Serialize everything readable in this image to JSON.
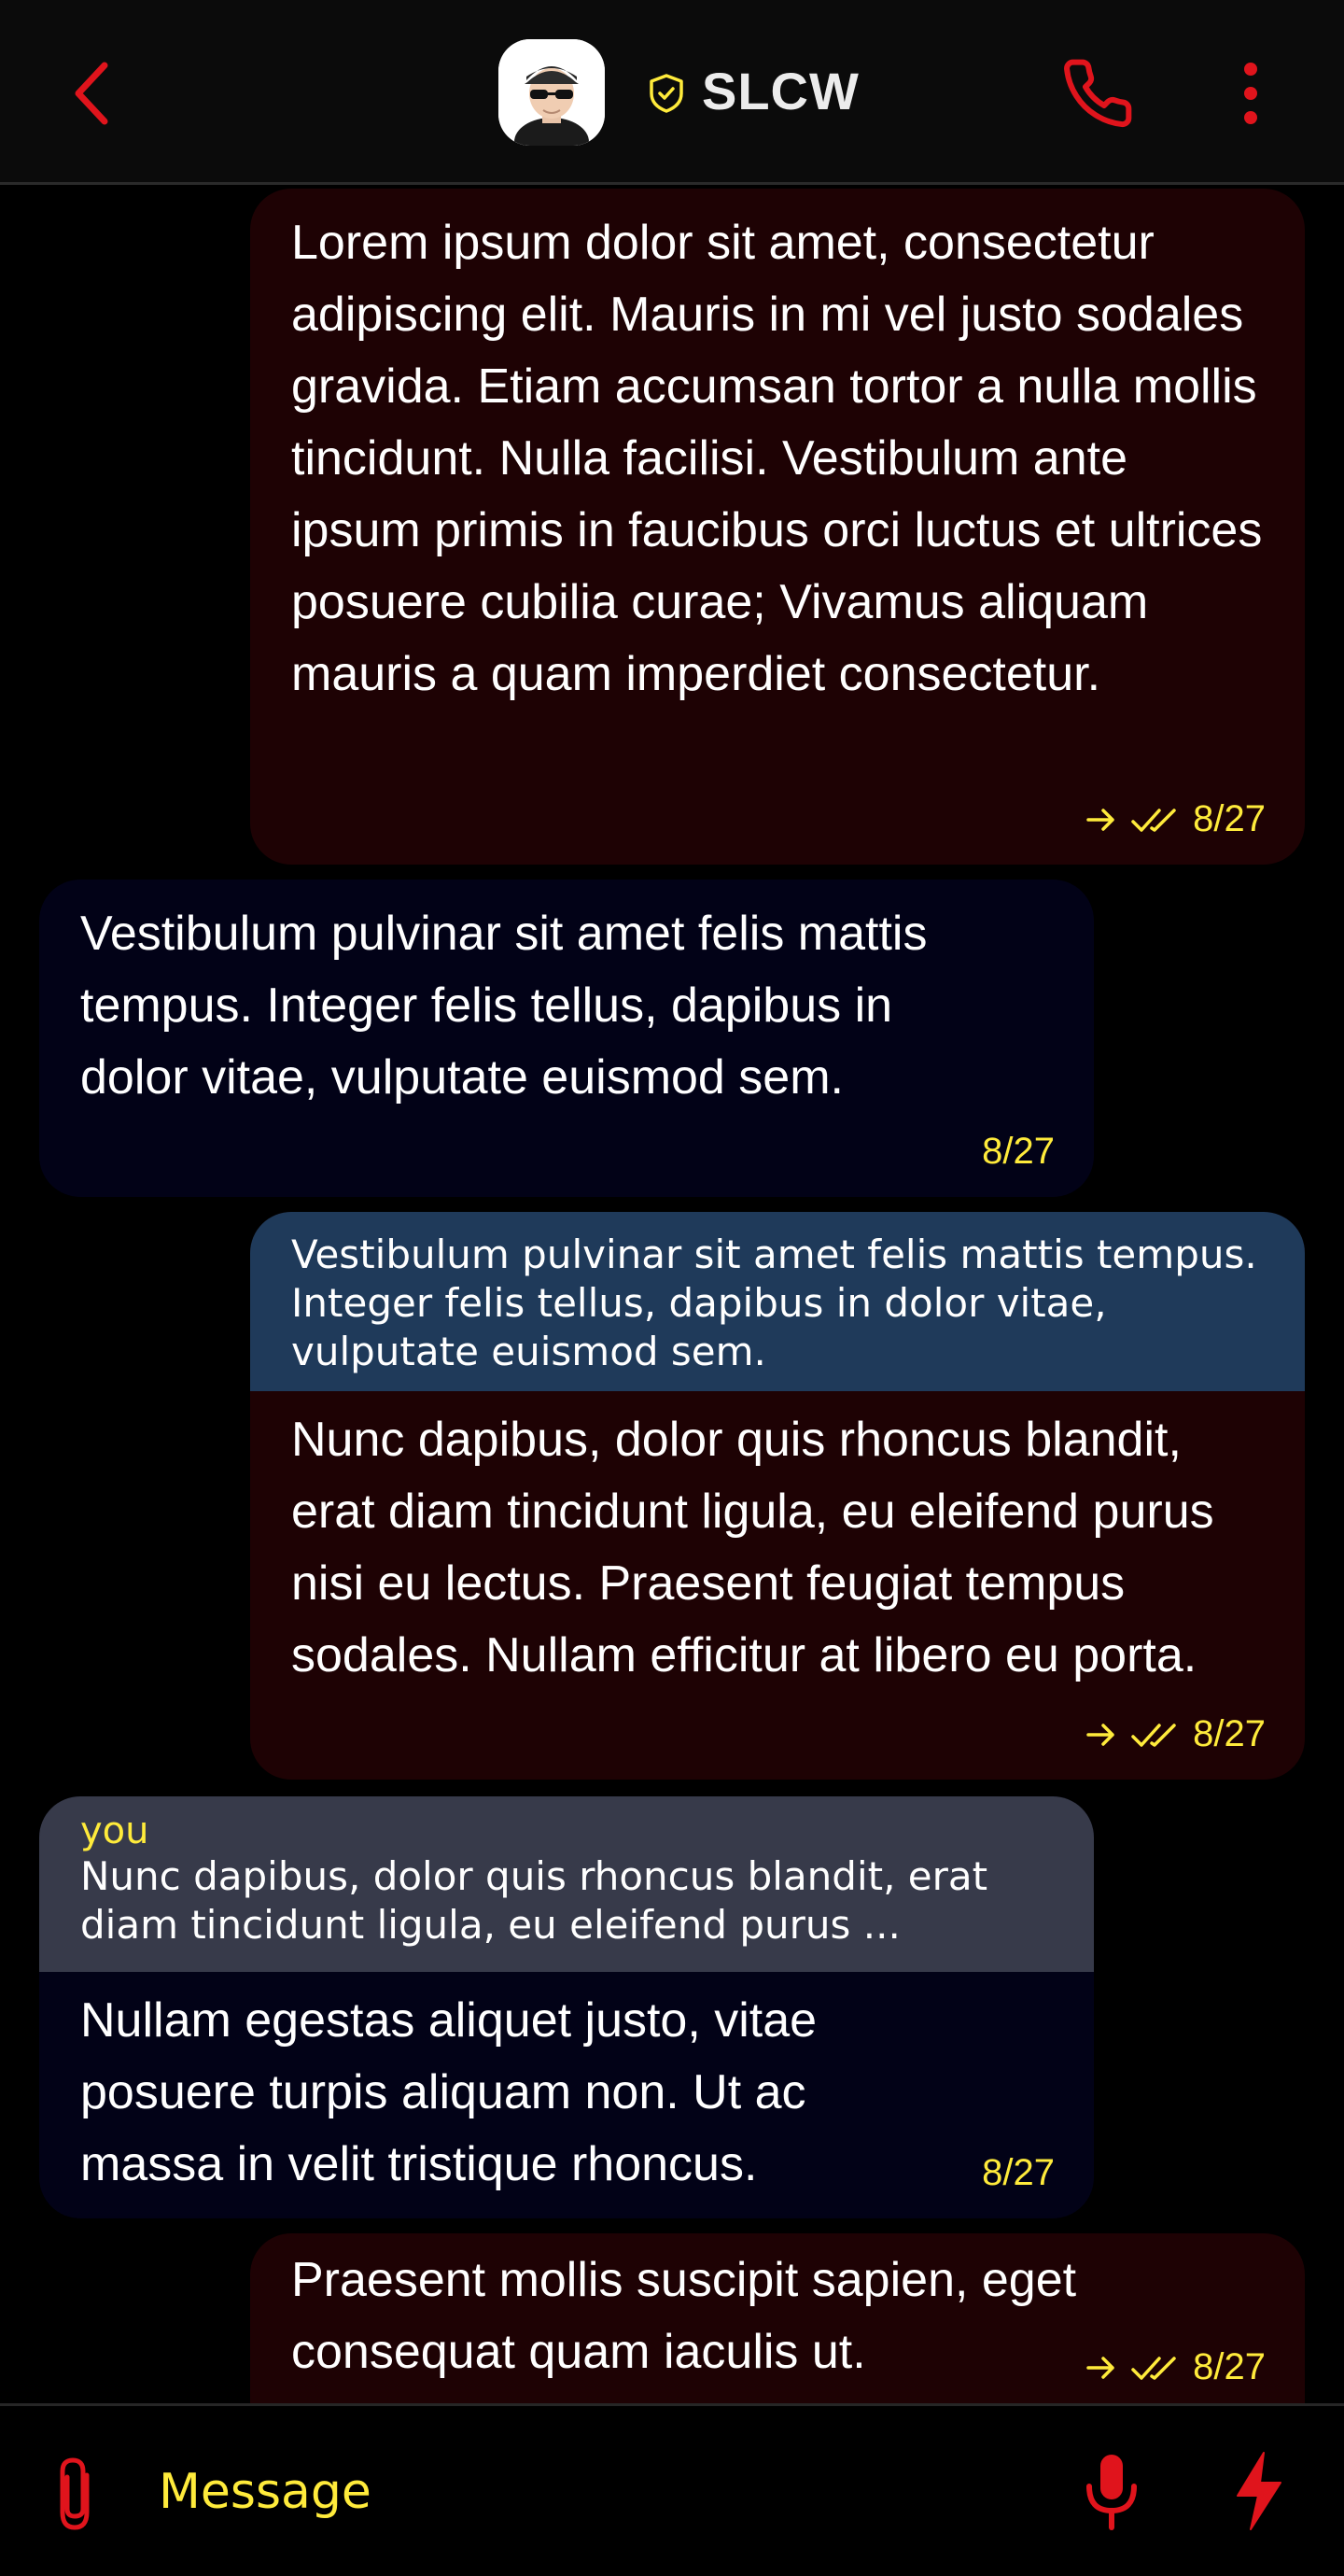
{
  "header": {
    "contact_name": "SLCW",
    "icons": [
      "chevron-left-icon",
      "avatar",
      "shield-check-icon",
      "phone-icon",
      "more-vertical-icon"
    ]
  },
  "colors": {
    "accent_red": "#e0141c",
    "accent_yellow": "#ffeb3b",
    "outgoing_bubble": "#1e0204",
    "incoming_bubble": "#020217",
    "quote_blue": "#1f3a5a",
    "quote_grey": "#373a4a"
  },
  "messages": [
    {
      "direction": "outgoing",
      "text": "Lorem ipsum dolor sit amet, consectetur adipiscing elit. Mauris in mi vel justo sodales gravida. Etiam accumsan tortor a nulla mollis tincidunt. Nulla facilisi. Vestibulum ante ipsum primis in faucibus orci luctus et ultrices posuere cubilia curae; Vivamus aliquam mauris a quam imperdiet consectetur.",
      "date": "8/27"
    },
    {
      "direction": "incoming",
      "text": "Vestibulum pulvinar sit amet felis mattis tempus. Integer felis tellus, dapibus in dolor vitae, vulputate euismod sem.",
      "date": "8/27"
    },
    {
      "direction": "outgoing",
      "quote": "Vestibulum pulvinar sit amet felis mattis tempus. Integer felis tellus, dapibus in dolor vitae, vulputate euismod sem.",
      "text": "Nunc dapibus, dolor quis rhoncus blandit, erat diam tincidunt ligula, eu eleifend purus nisi eu lectus. Praesent feugiat tempus sodales. Nullam efficitur at libero eu porta.",
      "date": "8/27"
    },
    {
      "direction": "incoming",
      "quote_author": "you",
      "quote": "Nunc dapibus, dolor quis rhoncus blandit, erat diam tincidunt ligula, eu eleifend purus ...",
      "text": "Nullam egestas aliquet justo, vitae posuere turpis aliquam non. Ut ac massa in velit tristique rhoncus.",
      "date": "8/27"
    },
    {
      "direction": "outgoing",
      "text": "Praesent mollis suscipit sapien, eget consequat quam iaculis ut.",
      "date": "8/27"
    }
  ],
  "composer": {
    "placeholder": "Message",
    "icons": [
      "paperclip-icon",
      "microphone-icon",
      "lightning-icon"
    ]
  }
}
